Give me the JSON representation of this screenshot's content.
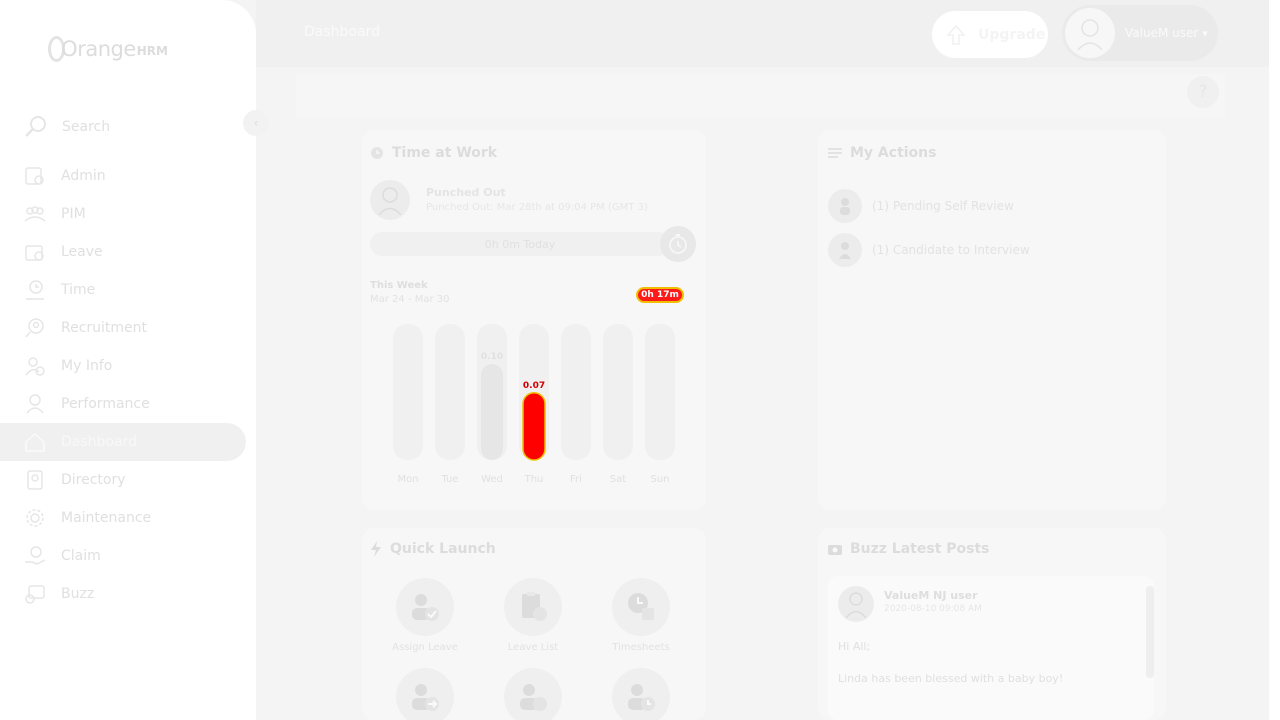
{
  "app": {
    "brand": {
      "main": "Orange",
      "suffix": "HRM"
    },
    "search_label": "Search",
    "collapse_glyph": "‹"
  },
  "sidebar": {
    "items": [
      {
        "label": "Admin",
        "icon": "admin-icon"
      },
      {
        "label": "PIM",
        "icon": "pim-icon"
      },
      {
        "label": "Leave",
        "icon": "leave-icon"
      },
      {
        "label": "Time",
        "icon": "time-icon"
      },
      {
        "label": "Recruitment",
        "icon": "recruitment-icon"
      },
      {
        "label": "My Info",
        "icon": "my-info-icon"
      },
      {
        "label": "Performance",
        "icon": "performance-icon"
      },
      {
        "label": "Dashboard",
        "icon": "dashboard-icon",
        "active": true
      },
      {
        "label": "Directory",
        "icon": "directory-icon"
      },
      {
        "label": "Maintenance",
        "icon": "maintenance-icon"
      },
      {
        "label": "Claim",
        "icon": "claim-icon"
      },
      {
        "label": "Buzz",
        "icon": "buzz-icon"
      }
    ]
  },
  "header": {
    "title": "Dashboard",
    "upgrade_label": "Upgrade",
    "user_name": "ValueM user",
    "caret": "▾",
    "help": "?"
  },
  "time_at_work": {
    "title": "Time at Work",
    "status": "Punched Out",
    "status_detail": "Punched Out: Mar 28th at 09:04 PM (GMT 3)",
    "today_label": "0h 0m Today",
    "week_label": "This Week",
    "week_range": "Mar 24 - Mar 30",
    "week_total": "0h 17m"
  },
  "chart_data": {
    "type": "bar",
    "categories": [
      "Mon",
      "Tue",
      "Wed",
      "Thu",
      "Fri",
      "Sat",
      "Sun"
    ],
    "values": [
      0,
      0,
      0.1,
      0.07,
      0,
      0,
      0
    ],
    "data_labels": [
      "",
      "",
      "0.10",
      "0.07",
      "",
      "",
      ""
    ],
    "highlight_index": 3,
    "ylim": [
      0,
      0.1
    ],
    "colors": {
      "track": "#f0f0f0",
      "bar": "#e6e6e6",
      "highlight": "#ff0000",
      "highlight_border": "#f0c000"
    }
  },
  "my_actions": {
    "title": "My Actions",
    "items": [
      {
        "label": "(1) Pending Self Review",
        "icon": "self-review-icon"
      },
      {
        "label": "(1) Candidate to Interview",
        "icon": "candidate-icon"
      }
    ]
  },
  "quick_launch": {
    "title": "Quick Launch",
    "items": [
      {
        "label": "Assign Leave",
        "icon": "assign-leave-icon"
      },
      {
        "label": "Leave List",
        "icon": "leave-list-icon"
      },
      {
        "label": "Timesheets",
        "icon": "timesheets-icon"
      },
      {
        "label": "",
        "icon": "apply-leave-icon"
      },
      {
        "label": "",
        "icon": "my-leave-icon"
      },
      {
        "label": "",
        "icon": "my-timesheet-icon"
      }
    ]
  },
  "buzz": {
    "title": "Buzz Latest Posts",
    "post": {
      "author": "ValueM NJ user",
      "date": "2020-08-10 09:08 AM",
      "line1": "Hi All;",
      "line2": "Linda has been blessed with a baby boy!"
    }
  }
}
